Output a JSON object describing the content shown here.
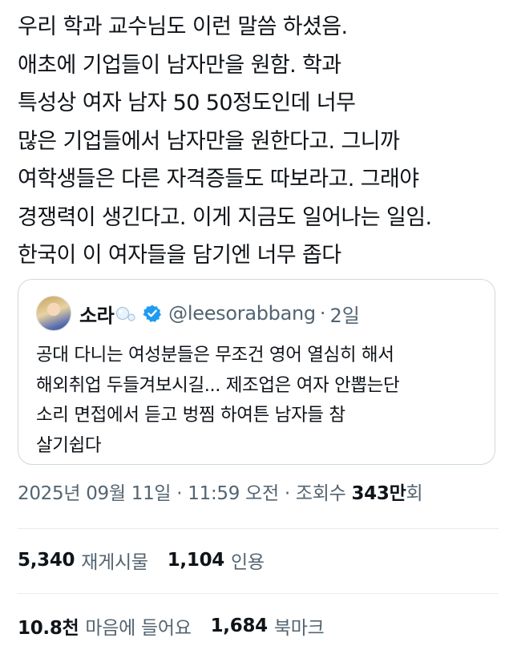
{
  "tweet": {
    "text": "우리 학과 교수님도 이런 말씀 하셨음.\n애초에 기업들이 남자만을 원함. 학과\n특성상 여자 남자 50 50정도인데 너무\n많은 기업들에서 남자만을 원한다고. 그니까\n여학생들은 다른 자격증들도 따보라고. 그래야\n경쟁력이 생긴다고. 이게 지금도 일어나는 일임.\n한국이 이 여자들을 담기엔 너무 좁다"
  },
  "quote": {
    "name": "소라",
    "handle": "@leesorabbang",
    "separator": "·",
    "time": "2일",
    "text": "공대 다니는 여성분들은 무조건 영어 열심히 해서\n해외취업 두들겨보시길... 제조업은 여자 안뽑는단\n소리 면접에서 듣고 벙찜 하여튼 남자들 참\n살기쉽다",
    "icons": {
      "name_emoji": "bubbles-icon",
      "verified": "verified-badge-icon"
    },
    "verified_color": "#1d9bf0"
  },
  "meta": {
    "date_time": "2025년 09월 11일 · 11:59 오전 · 조회수 ",
    "views": "343만",
    "views_suffix": "회"
  },
  "stats": {
    "reposts": "5,340",
    "reposts_label": "재게시물",
    "quotes": "1,104",
    "quotes_label": "인용",
    "likes": "10.8천",
    "likes_label": "마음에 들어요",
    "bookmarks": "1,684",
    "bookmarks_label": "북마크"
  }
}
